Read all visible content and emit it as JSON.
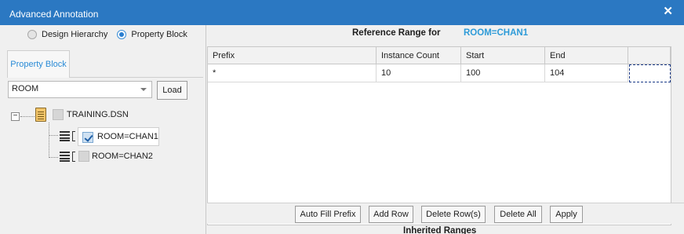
{
  "window": {
    "title": "Advanced Annotation",
    "close_glyph": "✕"
  },
  "mode": {
    "options": [
      {
        "label": "Design Hierarchy",
        "selected": false
      },
      {
        "label": "Property Block",
        "selected": true
      }
    ]
  },
  "left_tab": {
    "label": "Property Block"
  },
  "property_select": {
    "value": "ROOM"
  },
  "load_button": {
    "label": "Load"
  },
  "tree": {
    "root": {
      "label": "TRAINING.DSN",
      "icon": "design-file-icon",
      "expander": "−"
    },
    "children": [
      {
        "label": "ROOM=CHAN1",
        "checked": true
      },
      {
        "label": "ROOM=CHAN2",
        "checked": false
      }
    ]
  },
  "reference": {
    "title": "Reference Range for",
    "value": "ROOM=CHAN1"
  },
  "grid": {
    "columns": [
      "Prefix",
      "Instance Count",
      "Start",
      "End"
    ],
    "rows": [
      [
        "*",
        "10",
        "100",
        "104"
      ]
    ]
  },
  "buttons": {
    "auto_fill": "Auto Fill Prefix",
    "add_row": "Add Row",
    "delete_rows": "Delete Row(s)",
    "delete_all": "Delete All",
    "apply": "Apply"
  },
  "inherited": {
    "title": "Inherited Ranges"
  },
  "colors": {
    "titlebar": "#2b78c2",
    "accent": "#2e9bd8"
  }
}
